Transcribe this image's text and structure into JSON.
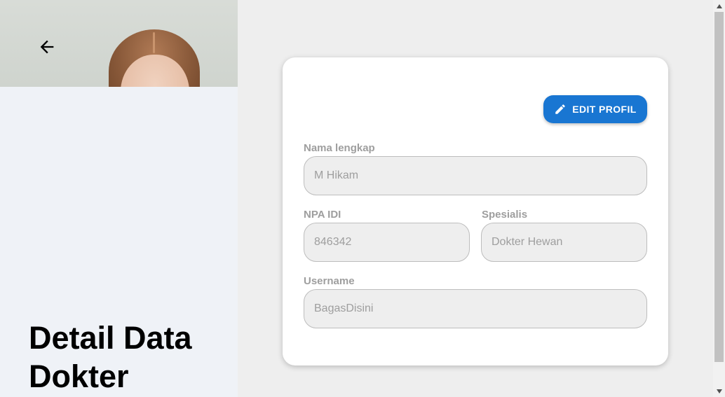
{
  "header": {
    "back_icon": "arrow-left-icon",
    "title": "Detail Data Dokter"
  },
  "card": {
    "edit_button": {
      "label": "EDIT PROFIL",
      "icon": "pencil-icon",
      "color": "#1976d2"
    },
    "fields": {
      "nama": {
        "label": "Nama lengkap",
        "value": "M Hikam"
      },
      "npa": {
        "label": "NPA IDI",
        "value": "846342"
      },
      "spesialis": {
        "label": "Spesialis",
        "value": "Dokter Hewan"
      },
      "username": {
        "label": "Username",
        "value": "BagasDisini"
      }
    }
  },
  "scrollbar": {
    "up_icon": "triangle-up-icon",
    "down_icon": "triangle-down-icon"
  }
}
